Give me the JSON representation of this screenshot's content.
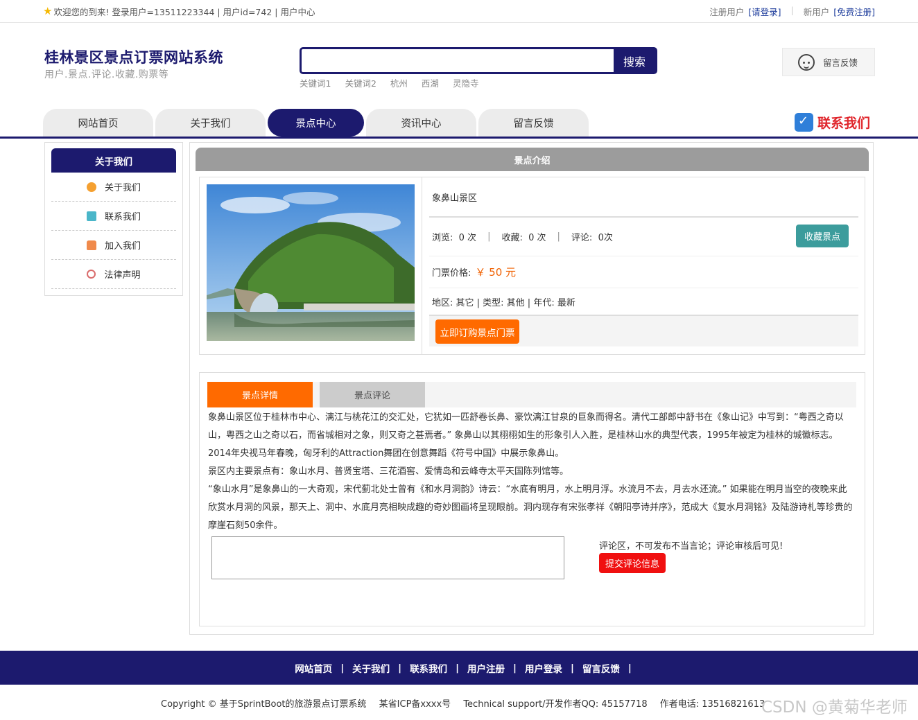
{
  "topbar": {
    "welcome": "欢迎您的到来!  登录用户=13511223344 | 用户id=742 | 用户中心",
    "registered_label": "注册用户",
    "login_link": "[请登录]",
    "new_user_label": "新用户",
    "register_link": "[免费注册]"
  },
  "header": {
    "title": "桂林景区景点订票网站系统",
    "subtitle": "用户.景点.评论.收藏.购票等",
    "search_placeholder": "",
    "search_button": "搜索",
    "hotwords": [
      "关键词1",
      "关键词2",
      "杭州",
      "西湖",
      "灵隐寺"
    ],
    "feedback_label": "留言反馈"
  },
  "nav": {
    "tabs": [
      "网站首页",
      "关于我们",
      "景点中心",
      "资讯中心",
      "留言反馈"
    ],
    "active_tab": "景点中心",
    "contact_label": "联系我们"
  },
  "sidebar": {
    "title": "关于我们",
    "items": [
      {
        "label": "关于我们",
        "icon": "coin-icon"
      },
      {
        "label": "联系我们",
        "icon": "clipboard-icon"
      },
      {
        "label": "加入我们",
        "icon": "lock-icon"
      },
      {
        "label": "法律声明",
        "icon": "power-icon"
      }
    ]
  },
  "main": {
    "section_title": "景点介绍",
    "spot_name": "象鼻山景区",
    "stats": {
      "views_label": "浏览:",
      "views_value": "0 次",
      "favorites_label": "收藏:",
      "favorites_value": "0 次",
      "comments_label": "评论:",
      "comments_value": "0次"
    },
    "favorite_button": "收藏景点",
    "price_label": "门票价格:",
    "price_value": "￥ 50 元",
    "attributes": "地区:  其它 | 类型:  其他 | 年代:  最新",
    "buy_button": "立即订购景点门票"
  },
  "detail": {
    "tabs": [
      "景点详情",
      "景点评论"
    ],
    "paragraphs": [
      "象鼻山景区位于桂林市中心、漓江与桃花江的交汇处，它犹如一匹舒卷长鼻、豪饮漓江甘泉的巨象而得名。清代工部郎中舒书在《象山记》中写到：“粤西之奇以山，粤西之山之奇以石，而省城相对之象，则又奇之甚焉者。” 象鼻山以其栩栩如生的形象引人入胜，是桂林山水的典型代表，1995年被定为桂林的城徽标志。2014年央视马年春晚，匈牙利的Attraction舞团在创意舞蹈《符号中国》中展示象鼻山。",
      "景区内主要景点有：象山水月、普贤宝塔、三花酒窖、爱情岛和云峰寺太平天国陈列馆等。",
      "“象山水月”是象鼻山的一大奇观，宋代蓟北处士曾有《和水月洞韵》诗云：“水底有明月，水上明月浮。水流月不去，月去水还流。” 如果能在明月当空的夜晚来此欣赏水月洞的风景，那天上、洞中、水底月亮相映成趣的奇妙图画将呈现眼前。洞内现存有宋张孝祥《朝阳亭诗并序》，范成大《复水月洞铭》及陆游诗札等珍贵的摩崖石刻50余件。"
    ],
    "comment_tip": "评论区，不可发布不当言论；评论审核后可见!",
    "submit_button": "提交评论信息"
  },
  "footer": {
    "links": [
      "网站首页",
      "关于我们",
      "联系我们",
      "用户注册",
      "用户登录",
      "留言反馈"
    ],
    "copyright": "Copyright © 基于SprintBoot的旅游景点订票系统",
    "icp": "某省ICP备xxxx号",
    "support": "Technical support/开发作者QQ:  45157718",
    "phone": "作者电话:  13516821613",
    "watermark": "CSDN @黄菊华老师"
  }
}
